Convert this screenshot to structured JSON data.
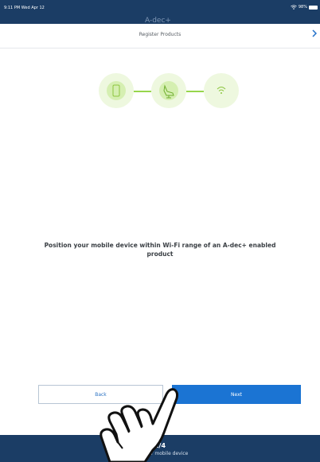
{
  "status_bar": {
    "time": "9:11 PM  Wed Apr 12",
    "battery": "98%"
  },
  "app": {
    "brand": "A-dec+"
  },
  "header": {
    "title": "Register Products",
    "close_icon": "close-icon"
  },
  "stepper": {
    "steps": [
      {
        "icon": "mobile-device-icon",
        "active": true
      },
      {
        "icon": "dental-chair-icon",
        "active": false
      },
      {
        "icon": "wifi-icon",
        "active": false
      }
    ],
    "colors": {
      "circle": "#eef8df",
      "inner": "#d5efb1",
      "line": "#97d64c",
      "icon": "#8dc63f"
    }
  },
  "main": {
    "instruction": "Position your mobile device within Wi-Fi range of an A-dec+ enabled product"
  },
  "buttons": {
    "back_label": "Back",
    "next_label": "Next"
  },
  "footer": {
    "progress": "2/4",
    "step_caption": "tion your mobile device"
  },
  "colors": {
    "navy": "#1b3d65",
    "primary": "#1b74d3"
  }
}
